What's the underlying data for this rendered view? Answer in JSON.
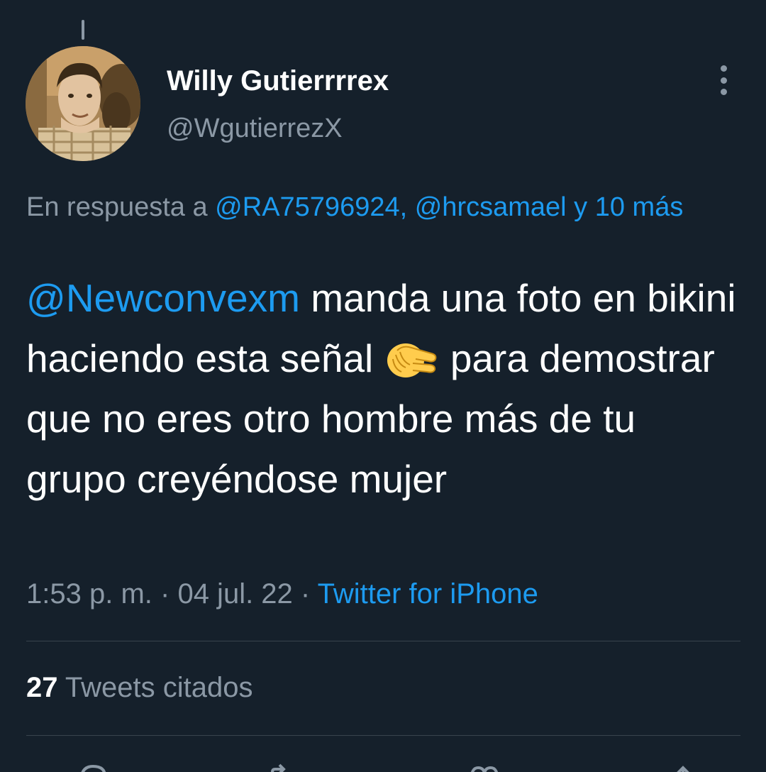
{
  "author": {
    "display_name": "Willy Gutierrrrex",
    "handle": "@WgutierrezX"
  },
  "reply": {
    "prefix": "En respuesta a",
    "user1": "@RA75796924,",
    "user2": "@hrcsamael",
    "others": "y 10 más"
  },
  "tweet": {
    "mention": "@Newconvexm",
    "text_part1": " manda una foto en bikini haciendo esta señal ",
    "emoji_icon": "pinching-hand-emoji",
    "text_part2": " para demostrar que no eres otro hombre más de tu grupo creyéndose mujer"
  },
  "meta": {
    "time": "1:53 p. m.",
    "separator": "·",
    "date": "04 jul. 22",
    "source": "Twitter for iPhone"
  },
  "stats": {
    "quote_count": "27",
    "quote_label": "Tweets citados"
  },
  "colors": {
    "background": "#15202b",
    "text_primary": "#ffffff",
    "text_secondary": "#8b98a5",
    "link": "#1d9bf0",
    "divider": "#38444d"
  },
  "icons": [
    "more-options-icon",
    "reply-icon",
    "retweet-icon",
    "like-icon",
    "share-icon"
  ]
}
